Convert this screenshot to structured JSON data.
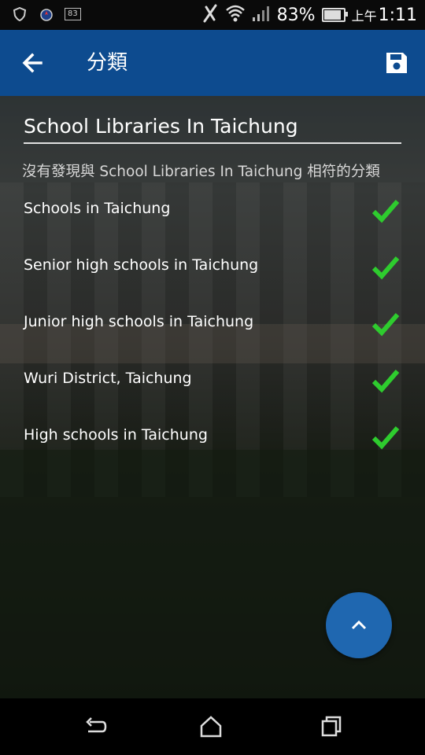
{
  "statusbar": {
    "notification_badge": "83",
    "battery_percent": "83%",
    "time_prefix": "上午",
    "time": "1:11"
  },
  "appbar": {
    "title": "分類",
    "back_icon": "arrow-left-icon",
    "save_icon": "save-icon"
  },
  "search": {
    "value": "School Libraries In Taichung"
  },
  "no_match_text": "沒有發現與 School Libraries In Taichung 相符的分類",
  "categories": [
    {
      "label": "Schools in Taichung",
      "checked": true
    },
    {
      "label": "Senior high schools in Taichung",
      "checked": true
    },
    {
      "label": "Junior high schools in Taichung",
      "checked": true
    },
    {
      "label": "Wuri District, Taichung",
      "checked": true
    },
    {
      "label": "High schools in Taichung",
      "checked": true
    }
  ],
  "colors": {
    "appbar": "#0d4b8f",
    "fab": "#1f67b0",
    "check": "#2ecc2e"
  }
}
